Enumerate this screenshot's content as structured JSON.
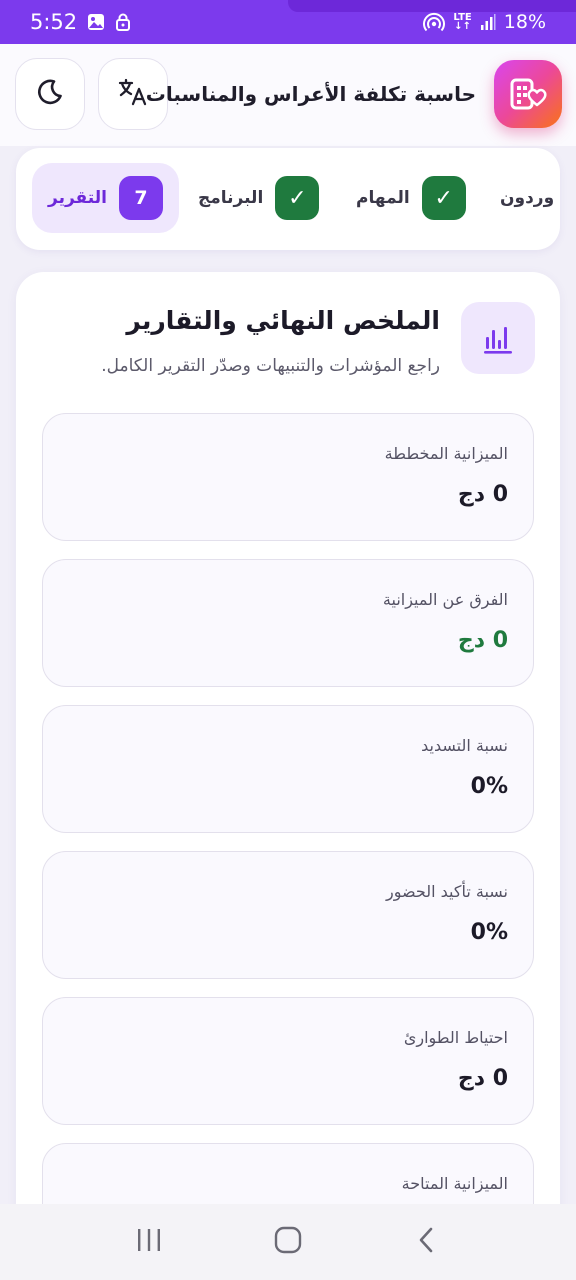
{
  "status_bar": {
    "time": "5:52",
    "lte_top": "LTE",
    "lte_bottom": "↓↑",
    "battery": "18%"
  },
  "header": {
    "title": "حاسبة تكلفة الأعراس والمناسبات"
  },
  "stepper": {
    "steps": [
      {
        "label": "وردون",
        "state": "partial"
      },
      {
        "label": "المهام",
        "state": "done",
        "badge": "✓"
      },
      {
        "label": "البرنامج",
        "state": "done",
        "badge": "✓"
      },
      {
        "label": "التقرير",
        "state": "active",
        "badge": "7"
      }
    ]
  },
  "section": {
    "title": "الملخص النهائي والتقارير",
    "subtitle": "راجع المؤشرات والتنبيهات وصدّر التقرير الكامل."
  },
  "metrics": [
    {
      "label": "الميزانية المخططة",
      "value": "0 دج",
      "color": "#1c1a28"
    },
    {
      "label": "الفرق عن الميزانية",
      "value": "0 دج",
      "color": "#1f7a3e"
    },
    {
      "label": "نسبة التسديد",
      "value": "0%",
      "color": "#1c1a28"
    },
    {
      "label": "نسبة تأكيد الحضور",
      "value": "0%",
      "color": "#1c1a28"
    },
    {
      "label": "احتياط الطوارئ",
      "value": "0 دج",
      "color": "#1c1a28"
    },
    {
      "label": "الميزانية المتاحة",
      "value": "",
      "color": "#1c1a28"
    }
  ],
  "icons": {
    "theme": "moon-icon",
    "language": "translate-icon",
    "logo": "app-logo-icon",
    "section": "bar-chart-icon"
  },
  "colors": {
    "accent": "#7c3aed",
    "success": "#1f7a3e",
    "accent_soft": "#efe7fd"
  }
}
